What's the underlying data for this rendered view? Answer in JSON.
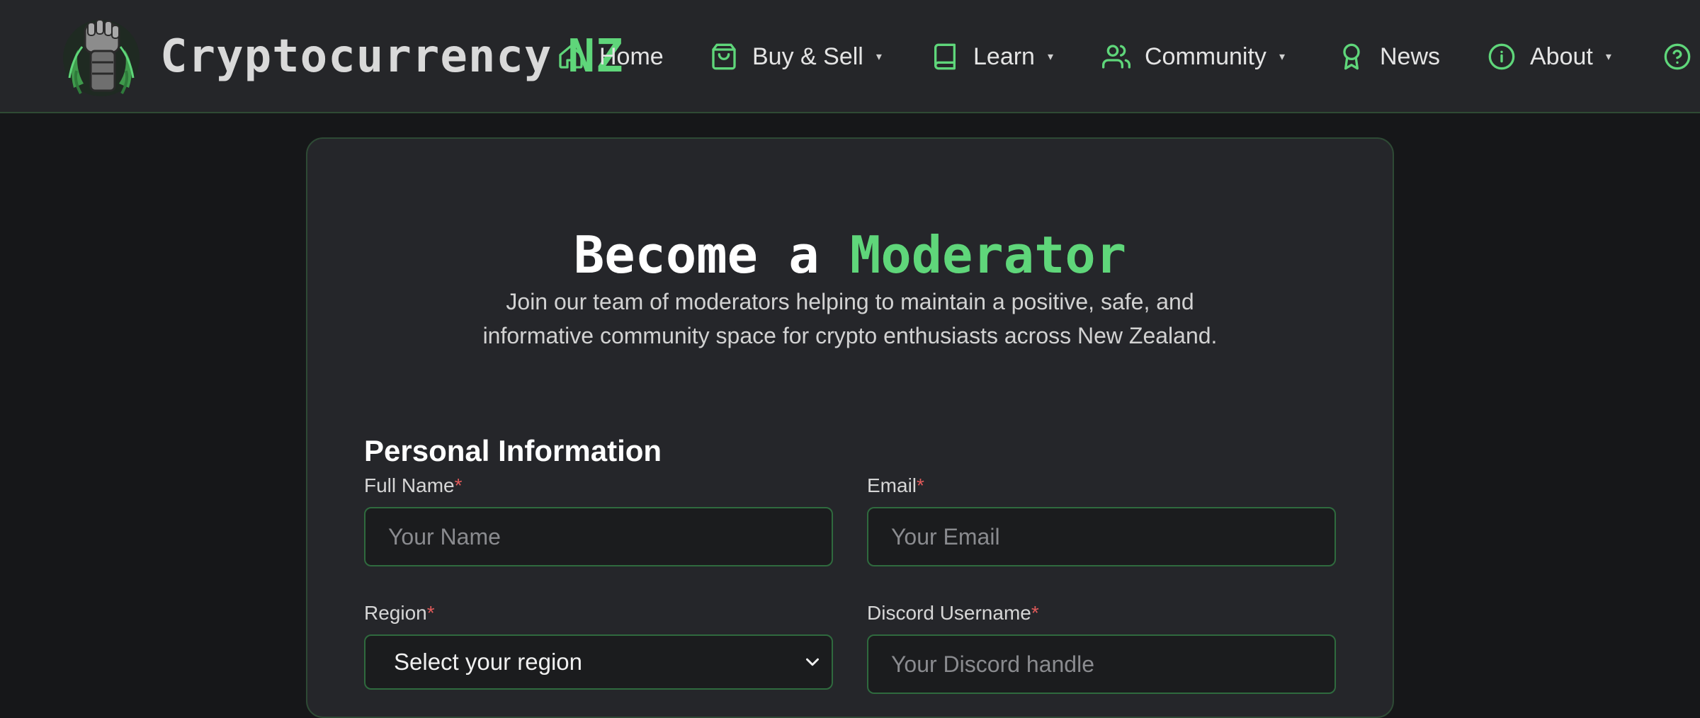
{
  "brand": {
    "name": "Cryptocurrency",
    "accent": "NZ",
    "logo_icon": "fist-with-fern-logo"
  },
  "nav": {
    "items": [
      {
        "label": "Home",
        "icon": "home-icon",
        "has_dropdown": false
      },
      {
        "label": "Buy & Sell",
        "icon": "shopping-bag-icon",
        "has_dropdown": true
      },
      {
        "label": "Learn",
        "icon": "book-icon",
        "has_dropdown": true
      },
      {
        "label": "Community",
        "icon": "users-icon",
        "has_dropdown": true
      },
      {
        "label": "News",
        "icon": "award-icon",
        "has_dropdown": false
      },
      {
        "label": "About",
        "icon": "info-icon",
        "has_dropdown": true
      }
    ],
    "caret": "▾",
    "help_icon": "help-circle-icon"
  },
  "page": {
    "title_part1": "Become a",
    "title_part2": "Moderator",
    "intro_line1": "Join our team of moderators helping to maintain a positive, safe, and",
    "intro_line2": "informative community space for crypto enthusiasts across New Zealand."
  },
  "form": {
    "section_title": "Personal Information",
    "required_marker": "*",
    "full_name": {
      "label": "Full Name",
      "placeholder": "Your Name",
      "value": ""
    },
    "email": {
      "label": "Email",
      "placeholder": "Your Email",
      "value": ""
    },
    "region": {
      "label": "Region",
      "selected": "Select your region"
    },
    "discord": {
      "label": "Discord Username",
      "placeholder": "Your Discord handle",
      "value": ""
    }
  },
  "colors": {
    "accent_green": "#5fd67a",
    "page_background": "#161719",
    "navbar_background": "#252629",
    "card_background": "#25262a",
    "input_border": "#2f6a3e",
    "required_red": "#e05a5a"
  }
}
